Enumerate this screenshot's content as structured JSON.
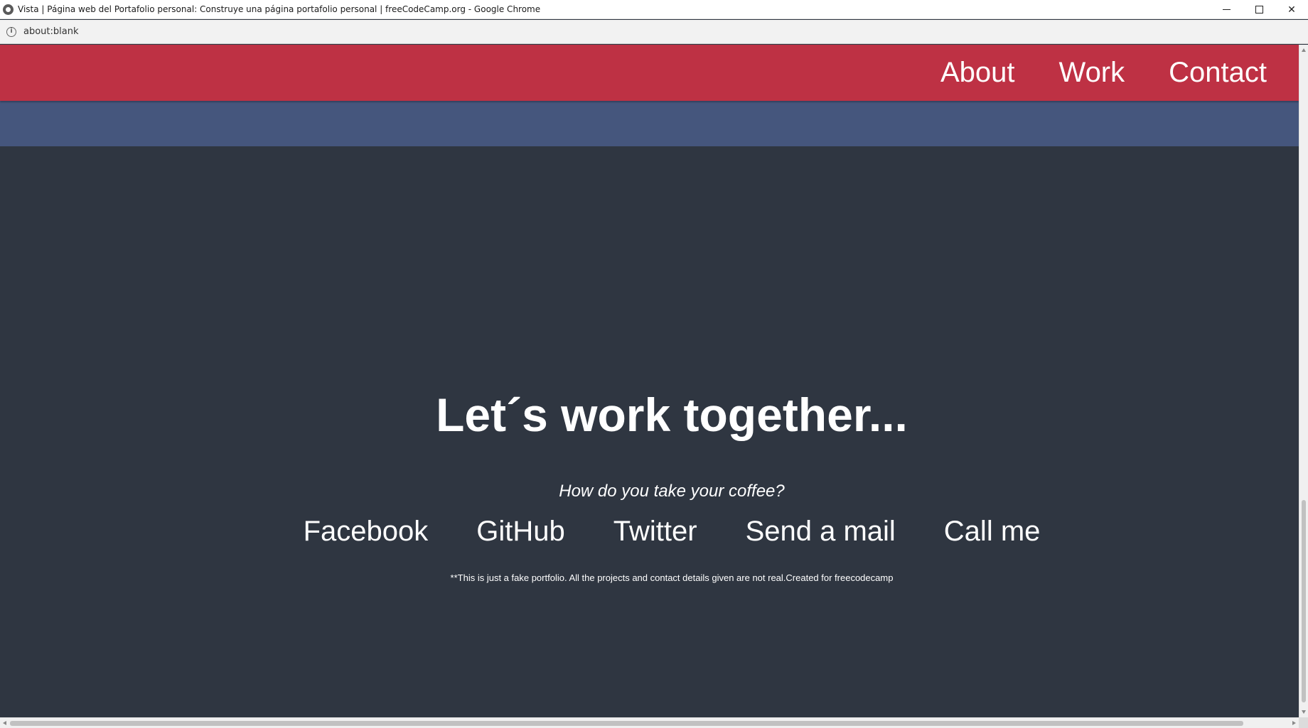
{
  "window": {
    "title": "Vista | Página web del Portafolio personal: Construye una página portafolio personal | freeCodeCamp.org - Google Chrome",
    "controls": {
      "minimize": "minimize-icon",
      "maximize": "maximize-icon",
      "close": "close-icon"
    }
  },
  "addressbar": {
    "url": "about:blank",
    "icon": "info-icon"
  },
  "navbar": {
    "links": [
      {
        "label": "About"
      },
      {
        "label": "Work"
      },
      {
        "label": "Contact"
      }
    ]
  },
  "contact": {
    "heading": "Let´s work together...",
    "subheading": "How do you take your coffee?",
    "links": [
      {
        "label": "Facebook"
      },
      {
        "label": "GitHub"
      },
      {
        "label": "Twitter"
      },
      {
        "label": "Send a mail"
      },
      {
        "label": "Call me"
      }
    ],
    "disclaimer": "**This is just a fake portfolio. All the projects and contact details given are not real.Created for freecodecamp"
  },
  "colors": {
    "navbar": "#be3144",
    "band": "#45567d",
    "background": "#2f3641",
    "text": "#ffffff"
  }
}
